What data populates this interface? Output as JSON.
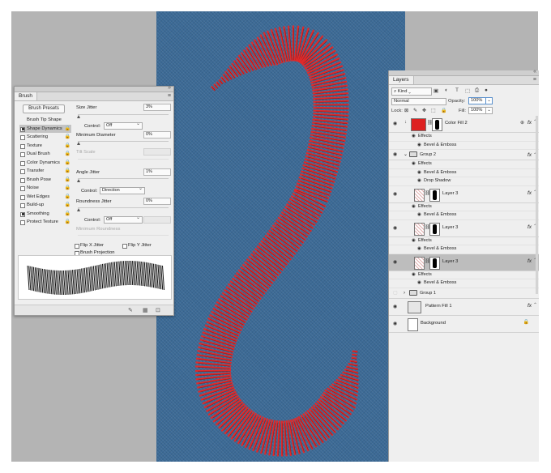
{
  "brush_panel": {
    "tab_label": "Brush",
    "presets_button": "Brush Presets",
    "list": [
      {
        "label": "Brush Tip Shape",
        "checkbox": false,
        "header": true,
        "selected": false
      },
      {
        "label": "Shape Dynamics",
        "checkbox": true,
        "checked": true,
        "selected": true
      },
      {
        "label": "Scattering",
        "checkbox": true,
        "checked": false,
        "selected": false
      },
      {
        "label": "Texture",
        "checkbox": true,
        "checked": false,
        "selected": false
      },
      {
        "label": "Dual Brush",
        "checkbox": true,
        "checked": false,
        "selected": false
      },
      {
        "label": "Color Dynamics",
        "checkbox": true,
        "checked": false,
        "selected": false
      },
      {
        "label": "Transfer",
        "checkbox": true,
        "checked": false,
        "selected": false
      },
      {
        "label": "Brush Pose",
        "checkbox": true,
        "checked": false,
        "selected": false
      },
      {
        "label": "Noise",
        "checkbox": true,
        "checked": false,
        "selected": false
      },
      {
        "label": "Wet Edges",
        "checkbox": true,
        "checked": false,
        "selected": false
      },
      {
        "label": "Build-up",
        "checkbox": true,
        "checked": false,
        "selected": false
      },
      {
        "label": "Smoothing",
        "checkbox": true,
        "checked": true,
        "selected": false
      },
      {
        "label": "Protect Texture",
        "checkbox": true,
        "checked": false,
        "selected": false
      }
    ],
    "size_jitter": {
      "label": "Size Jitter",
      "value": "3%"
    },
    "control_1": {
      "label": "Control:",
      "value": "Off"
    },
    "minimum_diameter": {
      "label": "Minimum Diameter",
      "value": "0%"
    },
    "tilt_scale": {
      "label": "Tilt Scale"
    },
    "angle_jitter": {
      "label": "Angle Jitter",
      "value": "1%"
    },
    "control_2": {
      "label": "Control:",
      "value": "Direction"
    },
    "roundness_jitter": {
      "label": "Roundness Jitter",
      "value": "0%"
    },
    "control_3": {
      "label": "Control:",
      "value": "Off"
    },
    "minimum_roundness": {
      "label": "Minimum Roundness"
    },
    "flip_x": "Flip X Jitter",
    "flip_y": "Flip Y Jitter",
    "brush_projection": "Brush Projection"
  },
  "layers_panel": {
    "tab_label": "Layers",
    "kind": "Kind",
    "blend_mode": "Normal",
    "opacity_label": "Opacity:",
    "opacity_value": "100%",
    "lock_label": "Lock:",
    "fill_label": "Fill:",
    "fill_value": "100%",
    "layers": [
      {
        "kind": "layer",
        "name": "Color Fill 2",
        "thumb": "red",
        "fx": true,
        "indent": 0
      },
      {
        "kind": "effects",
        "label": "Effects"
      },
      {
        "kind": "effect",
        "label": "Bevel & Emboss"
      },
      {
        "kind": "group",
        "name": "Group 2",
        "open": true,
        "fx": true
      },
      {
        "kind": "effects",
        "label": "Effects"
      },
      {
        "kind": "effect",
        "label": "Bevel & Emboss"
      },
      {
        "kind": "effect",
        "label": "Drop Shadow"
      },
      {
        "kind": "layer",
        "name": "Layer 3",
        "thumb": "pattern",
        "fx": true,
        "indent": 1
      },
      {
        "kind": "effects",
        "label": "Effects"
      },
      {
        "kind": "effect",
        "label": "Bevel & Emboss"
      },
      {
        "kind": "layer",
        "name": "Layer 3",
        "thumb": "pattern",
        "fx": true,
        "indent": 1
      },
      {
        "kind": "effects",
        "label": "Effects"
      },
      {
        "kind": "effect",
        "label": "Bevel & Emboss"
      },
      {
        "kind": "layer",
        "name": "Layer 3",
        "thumb": "pattern",
        "fx": true,
        "indent": 1,
        "selected": true
      },
      {
        "kind": "effects",
        "label": "Effects"
      },
      {
        "kind": "effect",
        "label": "Bevel & Emboss"
      },
      {
        "kind": "group",
        "name": "Group 1",
        "open": false,
        "fx": false,
        "hidden": true
      },
      {
        "kind": "layer",
        "name": "Pattern Fill 1",
        "thumb": "patfill",
        "fx": true,
        "indent": 0
      },
      {
        "kind": "layer",
        "name": "Background",
        "thumb": "white",
        "fx": false,
        "locked": true,
        "indent": 0
      }
    ]
  },
  "colors": {
    "denim": "#3c6a96",
    "stroke_red": "#e02a2a",
    "stitch_dark": "#7a1010",
    "selected_row": "#bdbdbd"
  }
}
